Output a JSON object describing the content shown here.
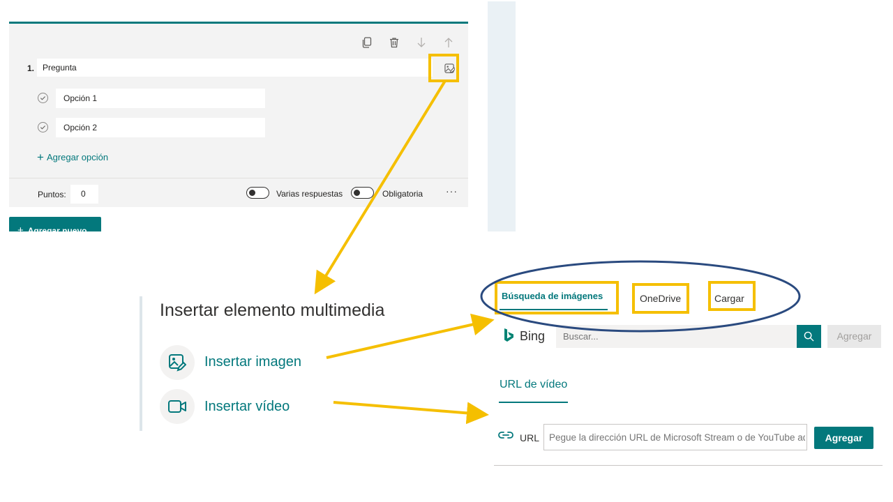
{
  "colors": {
    "accent": "#03787c",
    "highlight": "#f5bf00",
    "ellipse": "#2a4a7f"
  },
  "card": {
    "toolbar": {
      "copy_icon": "copy-icon",
      "delete_icon": "trash-icon",
      "down_icon": "arrow-down-icon",
      "up_icon": "arrow-up-icon"
    },
    "question_number": "1.",
    "question_title": "Pregunta",
    "media_icon": "insert-media-icon",
    "options": [
      {
        "label": "Opción 1"
      },
      {
        "label": "Opción 2"
      }
    ],
    "add_option": "Agregar opción",
    "points_label": "Puntos:",
    "points_value": "0",
    "multiple_answers": {
      "label": "Varias respuestas",
      "on": false
    },
    "required": {
      "label": "Obligatoria",
      "on": false
    },
    "more": "···"
  },
  "add_new_button": "Agregar nuevo",
  "insert_media": {
    "title": "Insertar elemento multimedia",
    "image_label": "Insertar imagen",
    "video_label": "Insertar vídeo"
  },
  "dialog": {
    "tabs": [
      "Búsqueda de imágenes",
      "OneDrive",
      "Cargar"
    ],
    "active_tab": "Búsqueda de imágenes",
    "bing_label": "Bing",
    "search_placeholder": "Buscar...",
    "add_image_button": "Agregar",
    "video_tab": "URL de vídeo",
    "url_label": "URL",
    "url_placeholder": "Pegue la dirección URL de Microsoft Stream o de YouTube aquí",
    "url_add_button": "Agregar"
  }
}
